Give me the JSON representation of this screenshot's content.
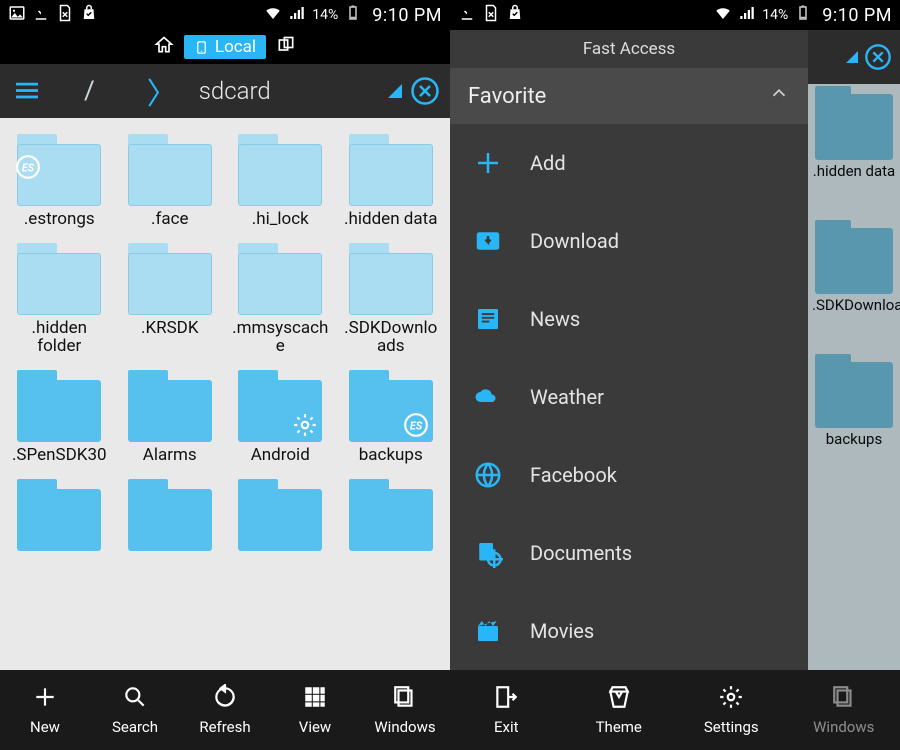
{
  "status": {
    "battery_pct": "14%",
    "clock": "9:10 PM"
  },
  "tabs": {
    "local_label": "Local"
  },
  "crumb": {
    "root": "/",
    "location": "sdcard"
  },
  "folders": [
    {
      "name": ".estrongs",
      "tone": "light",
      "overlay": "es-left"
    },
    {
      "name": ".face",
      "tone": "light"
    },
    {
      "name": ".hi_lock",
      "tone": "light"
    },
    {
      "name": ".hidden data",
      "tone": "light"
    },
    {
      "name": ".hidden folder",
      "tone": "light"
    },
    {
      "name": ".KRSDK",
      "tone": "light"
    },
    {
      "name": ".mmsyscache",
      "tone": "light"
    },
    {
      "name": ".SDKDownloads",
      "tone": "light"
    },
    {
      "name": ".SPenSDK30",
      "tone": "mid"
    },
    {
      "name": "Alarms",
      "tone": "mid"
    },
    {
      "name": "Android",
      "tone": "mid",
      "overlay": "gear"
    },
    {
      "name": "backups",
      "tone": "mid",
      "overlay": "es"
    },
    {
      "name": "",
      "tone": "mid"
    },
    {
      "name": "",
      "tone": "mid"
    },
    {
      "name": "",
      "tone": "mid"
    },
    {
      "name": "",
      "tone": "mid"
    }
  ],
  "bottom": [
    {
      "id": "new",
      "label": "New",
      "icon": "plus"
    },
    {
      "id": "search",
      "label": "Search",
      "icon": "search"
    },
    {
      "id": "refresh",
      "label": "Refresh",
      "icon": "refresh"
    },
    {
      "id": "view",
      "label": "View",
      "icon": "grid"
    },
    {
      "id": "windows",
      "label": "Windows",
      "icon": "windows"
    }
  ],
  "drawer": {
    "title": "Fast Access",
    "section": "Favorite",
    "items": [
      {
        "label": "Add",
        "icon": "plus"
      },
      {
        "label": "Download",
        "icon": "download"
      },
      {
        "label": "News",
        "icon": "news"
      },
      {
        "label": "Weather",
        "icon": "weather"
      },
      {
        "label": "Facebook",
        "icon": "globe"
      },
      {
        "label": "Documents",
        "icon": "docs"
      },
      {
        "label": "Movies",
        "icon": "movies"
      }
    ]
  },
  "bottom_right": [
    {
      "id": "exit",
      "label": "Exit",
      "icon": "exit"
    },
    {
      "id": "theme",
      "label": "Theme",
      "icon": "theme"
    },
    {
      "id": "settings",
      "label": "Settings",
      "icon": "settings"
    },
    {
      "id": "windows",
      "label": "Windows",
      "icon": "windows"
    }
  ],
  "peek": [
    {
      "name": ".hidden data"
    },
    {
      "name": ".SDKDownloads"
    },
    {
      "name": "backups"
    }
  ]
}
